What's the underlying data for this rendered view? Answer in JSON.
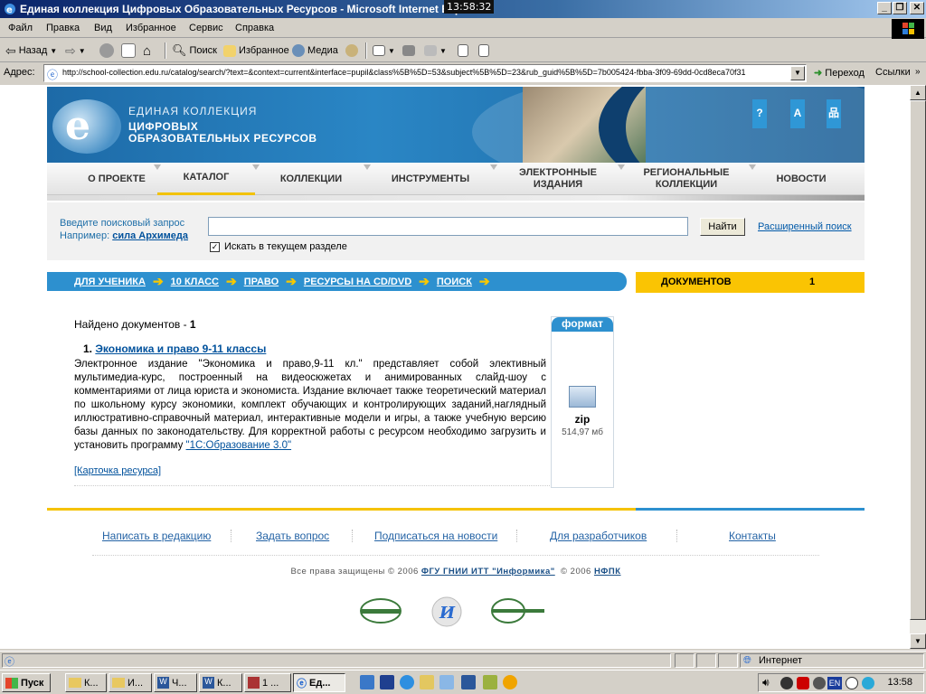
{
  "window": {
    "title": "Единая коллекция Цифровых Образовательных Ресурсов - Microsoft Internet Explorer",
    "clock_overlay": "13:58:32"
  },
  "menu": [
    "Файл",
    "Правка",
    "Вид",
    "Избранное",
    "Сервис",
    "Справка"
  ],
  "toolbar": {
    "back": "Назад",
    "search": "Поиск",
    "favorites": "Избранное",
    "media": "Медиа"
  },
  "address": {
    "label": "Адрес:",
    "url": "http://school-collection.edu.ru/catalog/search/?text=&context=current&interface=pupil&class%5B%5D=53&subject%5B%5D=23&rub_guid%5B%5D=7b005424-fbba-3f09-69dd-0cd8eca70f31",
    "go": "Переход",
    "links": "Ссылки"
  },
  "site": {
    "logo_line1": "ЕДИНАЯ КОЛЛЕКЦИЯ",
    "logo_line2": "ЦИФРОВЫХ",
    "logo_line3": "ОБРАЗОВАТЕЛЬНЫХ РЕСУРСОВ",
    "header_buttons": [
      "?",
      "A",
      "品"
    ],
    "nav": [
      {
        "label": "О ПРОЕКТЕ"
      },
      {
        "label": "КАТАЛОГ"
      },
      {
        "label": "КОЛЛЕКЦИИ"
      },
      {
        "label": "ИНСТРУМЕНТЫ"
      },
      {
        "label": "ЭЛЕКТРОННЫЕ ИЗДАНИЯ"
      },
      {
        "label": "РЕГИОНАЛЬНЫЕ КОЛЛЕКЦИИ"
      },
      {
        "label": "НОВОСТИ"
      }
    ]
  },
  "search": {
    "prompt": "Введите поисковый запрос",
    "example_label": "Например:",
    "example_link": "сила Архимеда",
    "value": "",
    "button": "Найти",
    "advanced": "Расширенный поиск",
    "checkbox_label": "Искать в текущем разделе",
    "checkbox_checked": true
  },
  "breadcrumbs": [
    "ДЛЯ УЧЕНИКА",
    "10 КЛАСС",
    "ПРАВО",
    "РЕСУРСЫ НА CD/DVD",
    "ПОИСК"
  ],
  "docs_counter": {
    "label": "ДОКУМЕНТОВ",
    "count": "1"
  },
  "results": {
    "found_label": "Найдено документов - ",
    "found_count": "1",
    "item_number": "1.",
    "item_title": "Экономика и право 9-11 классы",
    "description": "Электронное издание \"Экономика и право,9-11 кл.\" представляет собой элективный мультимедиа-курс, построенный на видеосюжетах и анимированных слайд-шоу с комментариями от лица юриста и экономиста. Издание включает также теоретический материал по школьному курсу экономики, комплект обучающих и контролирующих заданий,наглядный иллюстративно-справочный материал, интерактивные модели и игры, а также учебную версию базы данных по законодательству.",
    "install_note": "Для корректной работы с ресурсом необходимо загрузить и установить программу",
    "install_link": "\"1С:Образование 3.0\"",
    "card_link": "[Карточка ресурса]",
    "format_header": "формат",
    "format_name": "zip",
    "format_size": "514,97 мб"
  },
  "footer": {
    "links": [
      "Написать в редакцию",
      "Задать вопрос",
      "Подписаться на новости",
      "Для разработчиков",
      "Контакты"
    ],
    "copyright_prefix": "Все права защищены © 2006",
    "copyright_org1": "ФГУ ГНИИ ИТТ \"Информика\"",
    "copyright_mid": "© 2006",
    "copyright_org2": "НФПК"
  },
  "statusbar": {
    "zone": "Интернет"
  },
  "taskbar": {
    "start": "Пуск",
    "buttons": [
      "К...",
      "И...",
      "Ч...",
      "К...",
      "1 ...",
      "Ед..."
    ],
    "time": "13:58"
  },
  "colors": {
    "brand_blue": "#2d90cf",
    "brand_yellow": "#fac403",
    "link": "#00519c"
  }
}
